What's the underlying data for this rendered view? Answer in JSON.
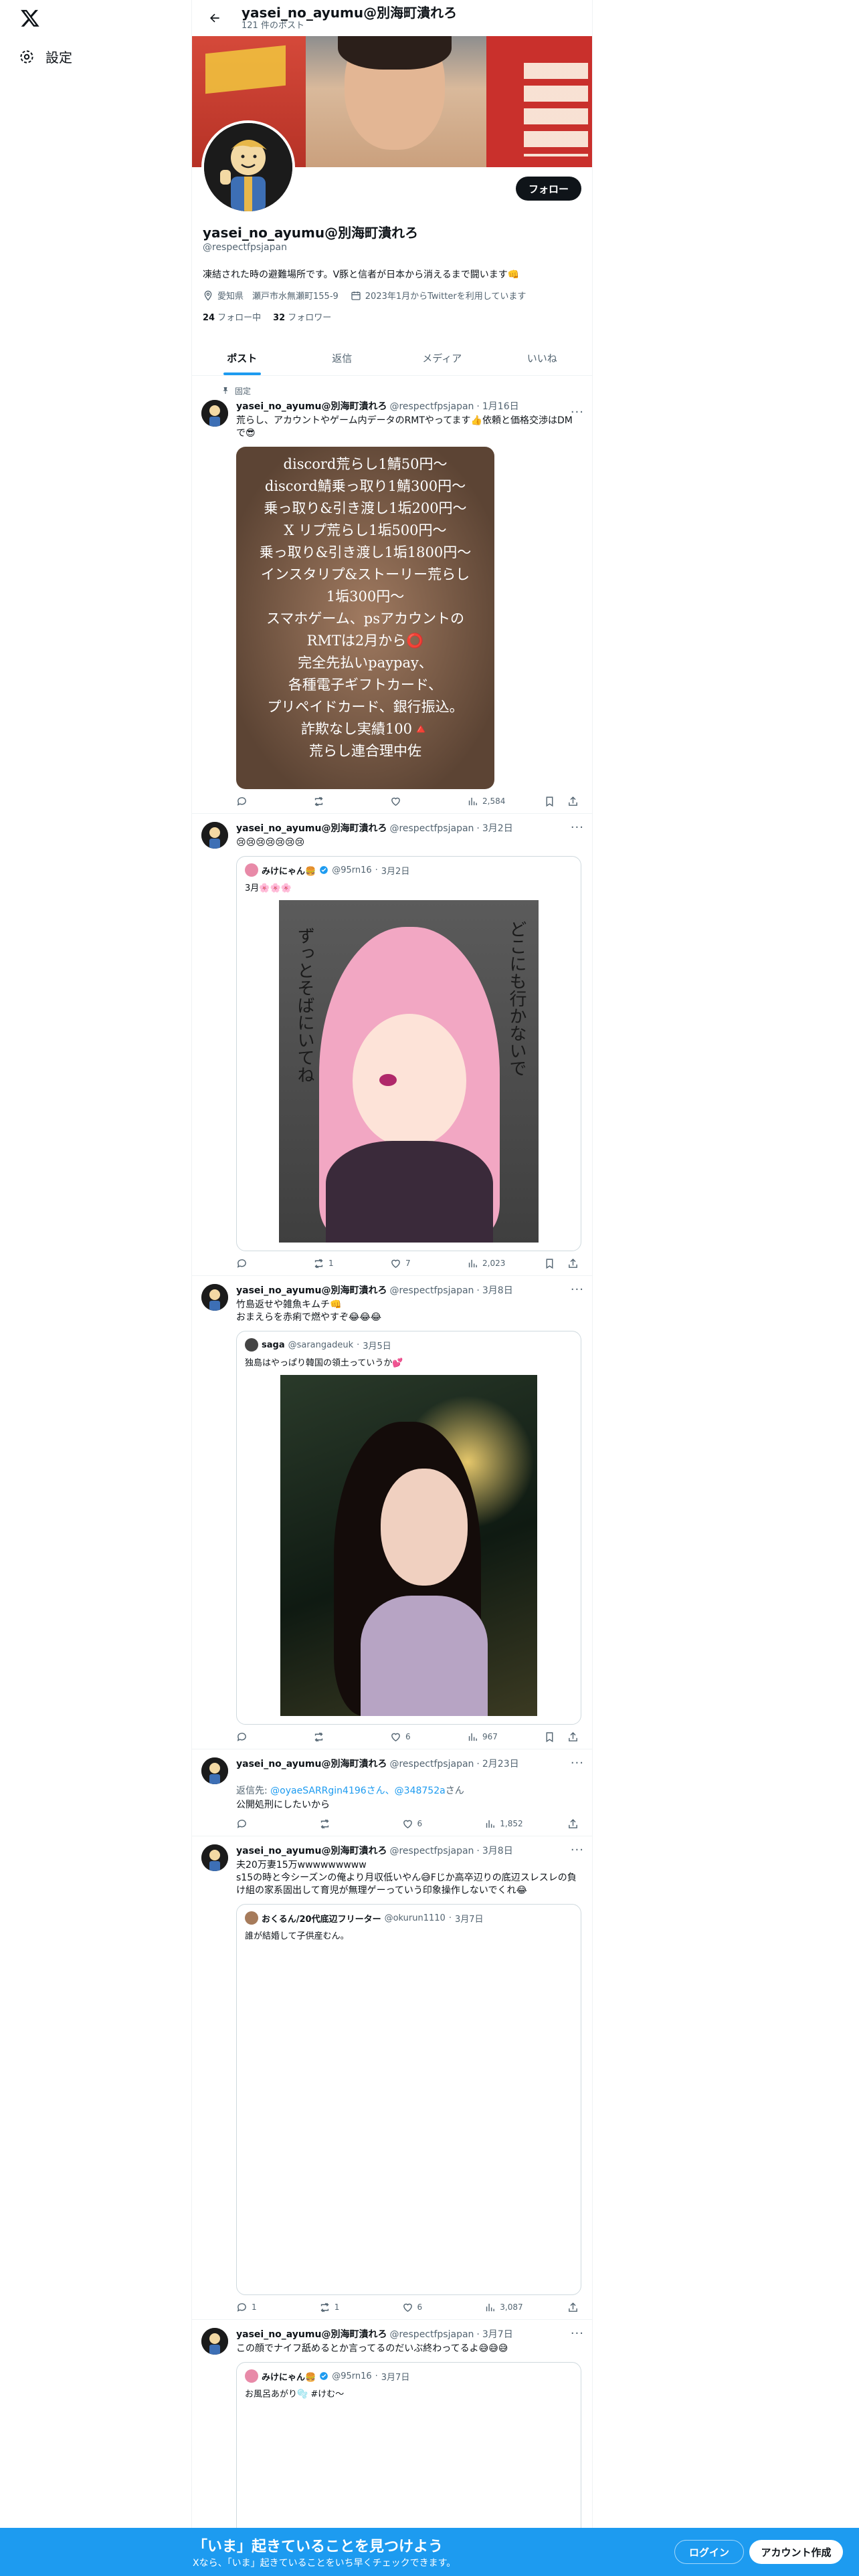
{
  "nav": {
    "settings_label": "設定"
  },
  "header": {
    "name": "yasei_no_ayumu@別海町潰れろ",
    "post_count": "121 件のポスト"
  },
  "profile": {
    "follow_label": "フォロー",
    "name": "yasei_no_ayumu@別海町潰れろ",
    "handle": "@respectfpsjapan",
    "bio": "凍結された時の避難場所です。V豚と信者が日本から消えるまで闘います👊",
    "location": "愛知県　瀬戸市水無瀬町155-9",
    "joined": "2023年1月からTwitterを利用しています",
    "following_count": "24",
    "following_label": "フォロー中",
    "followers_count": "32",
    "followers_label": "フォロワー"
  },
  "tabs": [
    "ポスト",
    "返信",
    "メディア",
    "いいね"
  ],
  "pinned_label": "固定",
  "tweets": [
    {
      "name": "yasei_no_ayumu@別海町潰れろ",
      "handle": "@respectfpsjapan",
      "date": "1月16日",
      "text": "荒らし、アカウントやゲーム内データのRMTやってます👍依頼と価格交渉はDMで😎",
      "image_lines": [
        "discord荒らし1鯖50円〜",
        "discord鯖乗っ取り1鯖300円〜",
        "乗っ取り&引き渡し1垢200円〜",
        "X リプ荒らし1垢500円〜",
        "乗っ取り&引き渡し1垢1800円〜",
        "インスタリプ&ストーリー荒らし",
        "1垢300円〜",
        "スマホゲーム、psアカウントの",
        "RMTは2月から⭕",
        "完全先払いpaypay、",
        "各種電子ギフトカード、",
        "プリペイドカード、銀行振込。",
        "詐欺なし実績100🔺",
        "荒らし連合理中佐"
      ],
      "views": "2,584"
    },
    {
      "name": "yasei_no_ayumu@別海町潰れろ",
      "handle": "@respectfpsjapan",
      "date": "3月2日",
      "text": "😢😢😢😢😢😢😢",
      "quote": {
        "name": "みけにゃん🍔",
        "handle": "@95rn16",
        "date": "3月2日",
        "text": "3月🌸🌸🌸",
        "art_text_right": "どこにも行かないで",
        "art_text_left": "ずっとそばにいてね"
      },
      "retweets": "1",
      "likes": "7",
      "views": "2,023"
    },
    {
      "name": "yasei_no_ayumu@別海町潰れろ",
      "handle": "@respectfpsjapan",
      "date": "3月8日",
      "text": "竹島返せや雑魚キムチ👊\nおまえらを赤痢で燃やすぞ😂😂😂",
      "quote": {
        "name": "saga",
        "handle": "@sarangadeuk",
        "date": "3月5日",
        "text": "独島はやっぱり韓国の領土っていうか💕"
      },
      "likes": "6",
      "views": "967"
    },
    {
      "name": "yasei_no_ayumu@別海町潰れろ",
      "handle": "@respectfpsjapan",
      "date": "2月23日",
      "reply_prefix": "返信先: ",
      "reply_to": "@oyaeSARRgin4196さん、@348752a",
      "reply_suffix": "さん",
      "text": "公開処刑にしたいから",
      "likes": "6",
      "views": "1,852"
    },
    {
      "name": "yasei_no_ayumu@別海町潰れろ",
      "handle": "@respectfpsjapan",
      "date": "3月8日",
      "text": "夫20万妻15万wwwwwwwww\ns15の時と今シーズンの俺より月収低いやん😅Fじか高卒辺りの底辺スレスレの負け組の家系固出して育児が無理ゲーっていう印象操作しないでくれ😂",
      "quote": {
        "name": "おくるん/20代底辺フリーター",
        "handle": "@okurun1110",
        "date": "3月7日",
        "text": "誰が結婚して子供産むん。"
      },
      "replies": "1",
      "retweets": "1",
      "likes": "6",
      "views": "3,087"
    },
    {
      "name": "yasei_no_ayumu@別海町潰れろ",
      "handle": "@respectfpsjapan",
      "date": "3月7日",
      "text": "この顔でナイフ舐めるとか言ってるのだいぶ終わってるよ😅😅😅",
      "quote": {
        "name": "みけにゃん🍔",
        "handle": "@95rn16",
        "date": "3月7日",
        "text": "お風呂あがり🫧 #けむ〜"
      }
    }
  ],
  "banner": {
    "title": "「いま」起きていることを見つけよう",
    "subtitle": "Xなら、「いま」起きていることをいち早くチェックできます。",
    "login": "ログイン",
    "signup": "アカウント作成"
  }
}
